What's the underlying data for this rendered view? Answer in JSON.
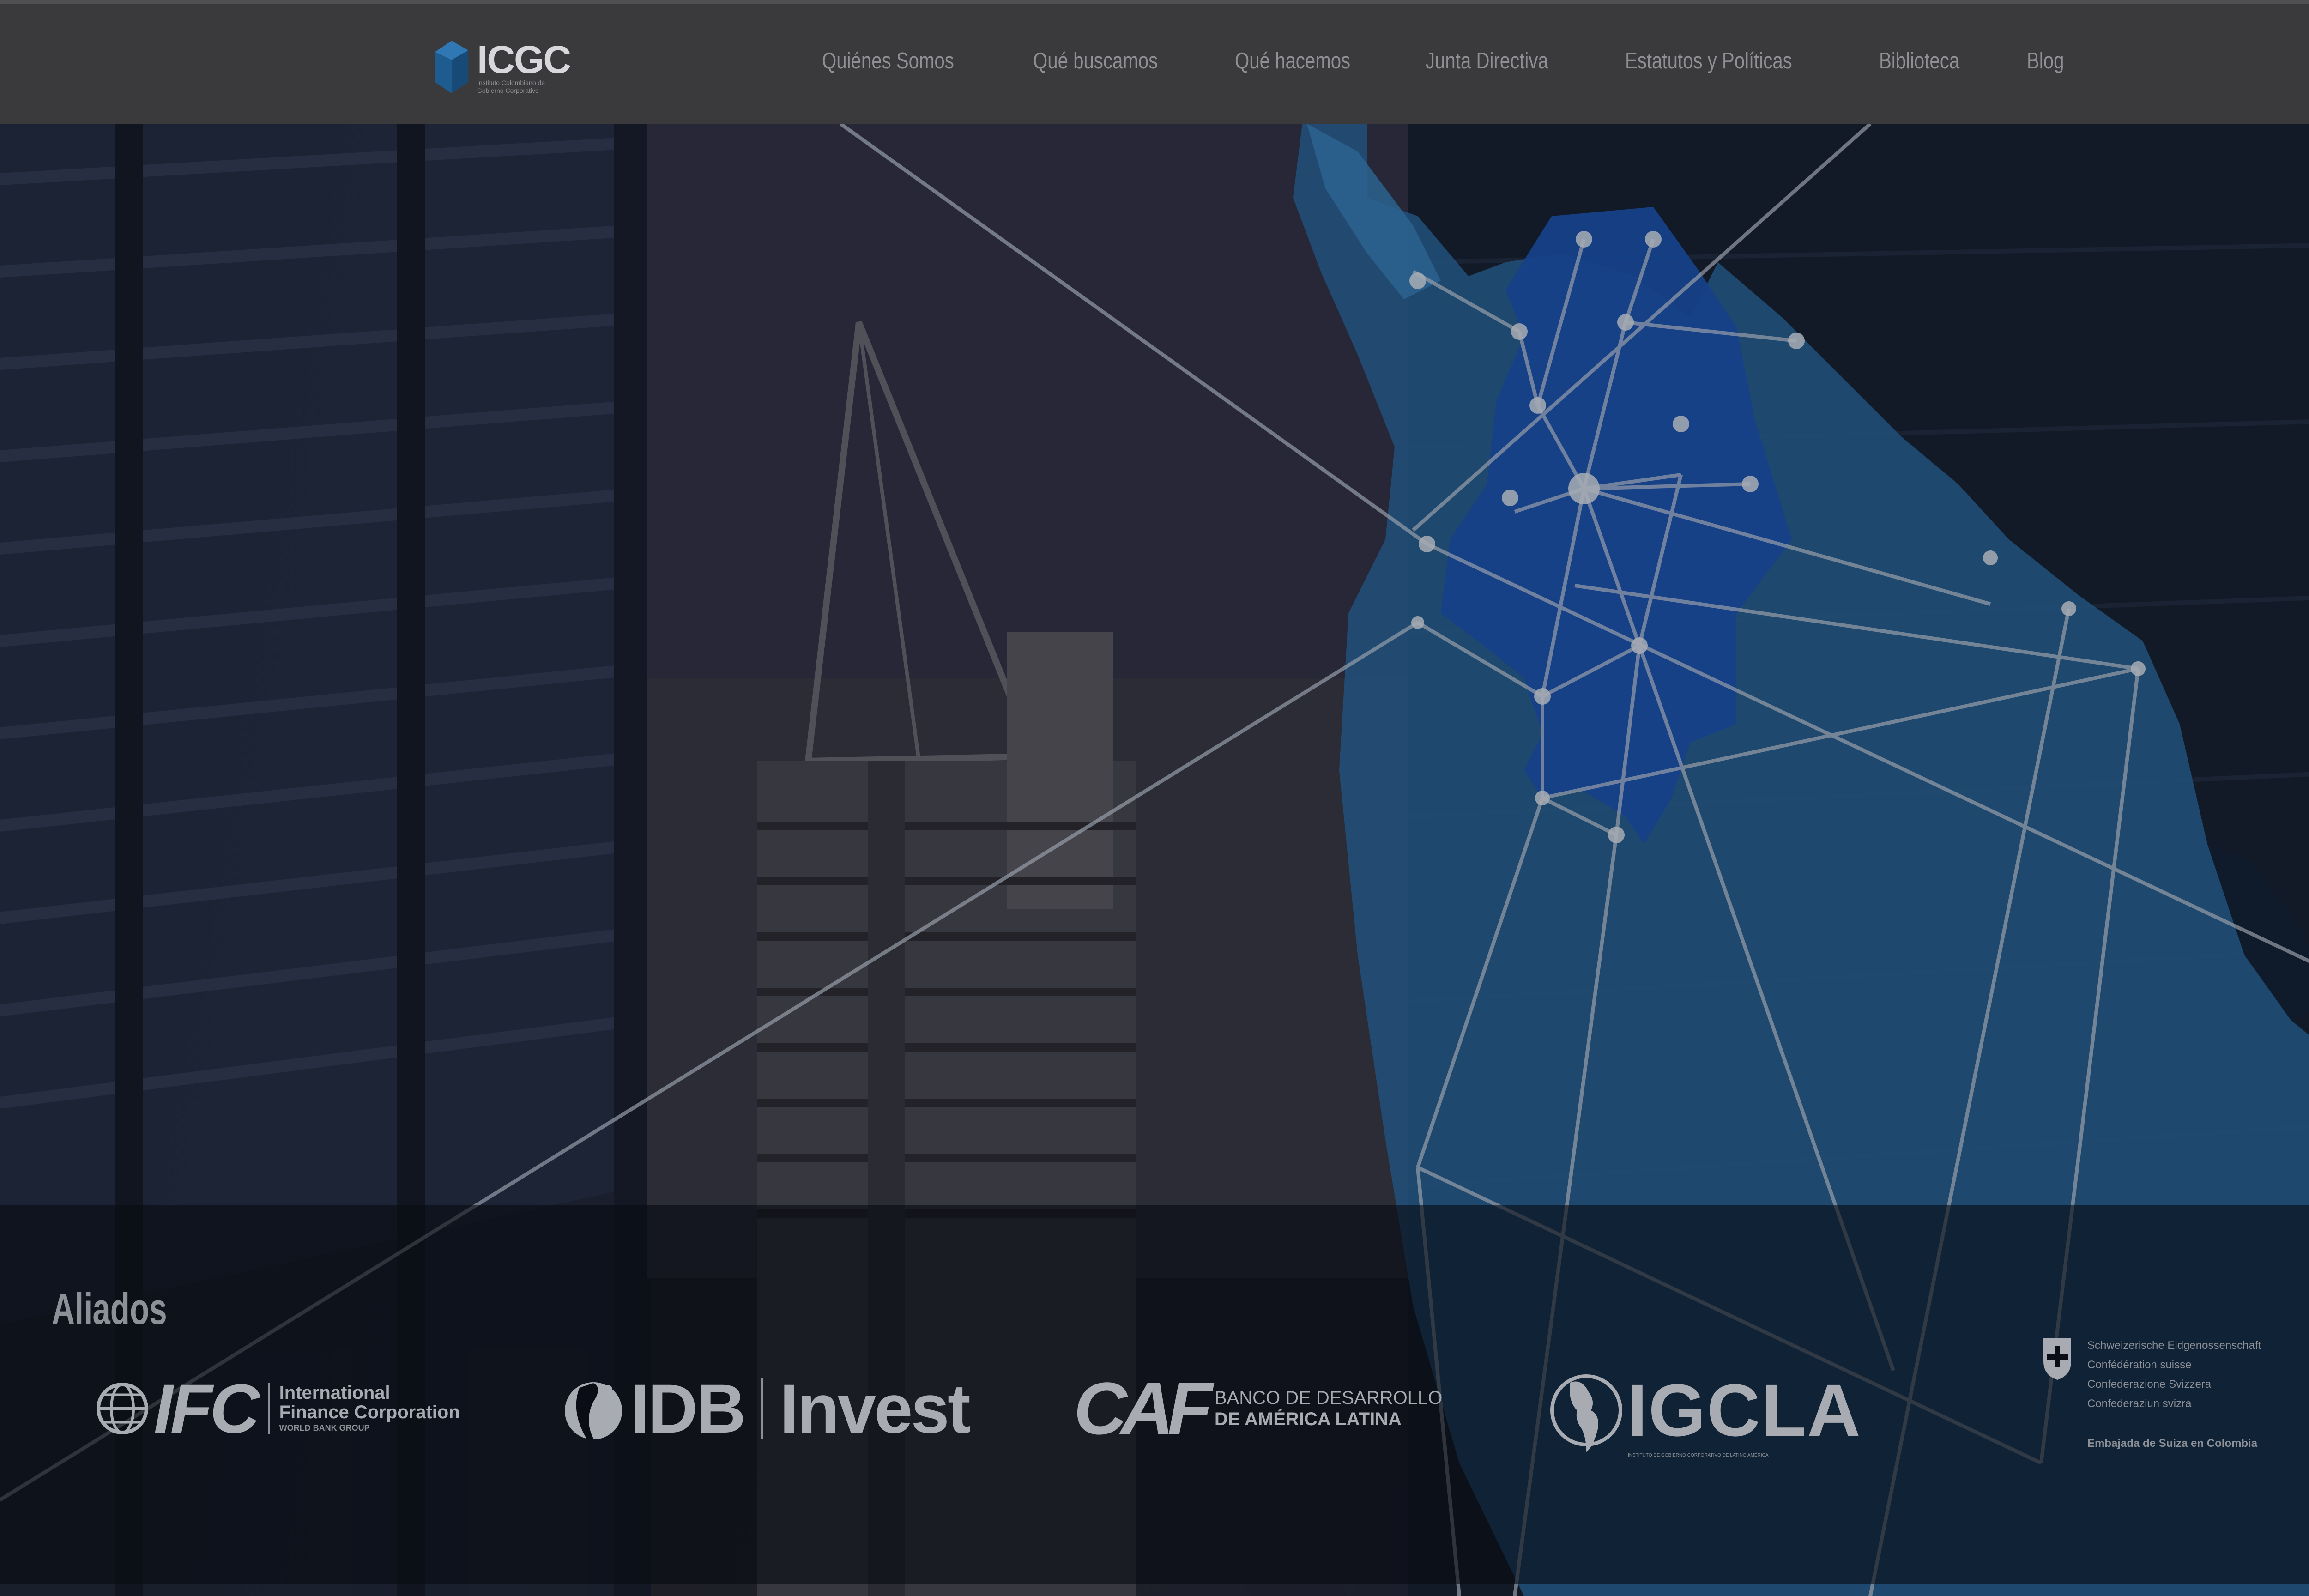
{
  "brand": {
    "name": "ICGC",
    "subtitle": "Instituto Colombiano de Gobierno Corporativo",
    "accent": "#1e5b8f"
  },
  "nav": {
    "items": [
      {
        "label": "Quiénes Somos"
      },
      {
        "label": "Qué buscamos"
      },
      {
        "label": "Qué hacemos"
      },
      {
        "label": "Junta Directiva"
      },
      {
        "label": "Estatutos y Políticas"
      },
      {
        "label": "Biblioteca"
      },
      {
        "label": "Blog"
      }
    ]
  },
  "hero": {
    "map_color": "#1f66b8",
    "map_highlight": "#1d55b6"
  },
  "partners": {
    "title": "Aliados",
    "ifc": {
      "mark": "IFC",
      "line1": "International",
      "line2": "Finance Corporation",
      "line3": "WORLD BANK GROUP"
    },
    "idb": {
      "mark": "IDB",
      "word": "Invest"
    },
    "caf": {
      "mark": "CAF",
      "line1": "BANCO DE DESARROLLO",
      "line2": "DE AMÉRICA LATINA"
    },
    "igcla": {
      "mark": "IGCLA",
      "sub": "INSTITUTO DE GOBIERNO CORPORATIVO DE LATINO AMÉRICA"
    },
    "swiss": {
      "line1": "Schweizerische Eidgenossenschaft",
      "line2": "Confédération suisse",
      "line3": "Confederazione Svizzera",
      "line4": "Confederaziun svizra",
      "embassy": "Embajada de Suiza en Colombia"
    }
  }
}
